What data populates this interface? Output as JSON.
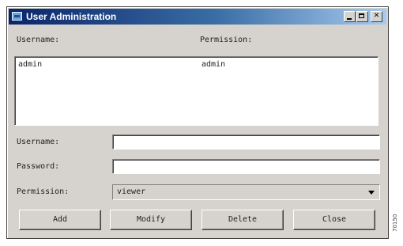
{
  "window": {
    "title": "User Administration"
  },
  "list": {
    "header_username": "Username:",
    "header_permission": "Permission:",
    "rows": [
      {
        "username": "admin",
        "permission": "admin"
      }
    ]
  },
  "form": {
    "username_label": "Username:",
    "username_value": "",
    "password_label": "Password:",
    "password_value": "",
    "permission_label": "Permission:",
    "permission_value": "viewer"
  },
  "buttons": {
    "add": "Add",
    "modify": "Modify",
    "delete": "Delete",
    "close": "Close"
  },
  "figure_id": "70150",
  "colors": {
    "titlebar_start": "#0a246a",
    "titlebar_end": "#a6caf0",
    "window_bg": "#d6d3ce"
  },
  "icons": {
    "title": "app-window-icon",
    "minimize": "minimize-icon",
    "maximize": "maximize-icon",
    "close": "close-icon",
    "dropdown": "chevron-down-icon"
  }
}
